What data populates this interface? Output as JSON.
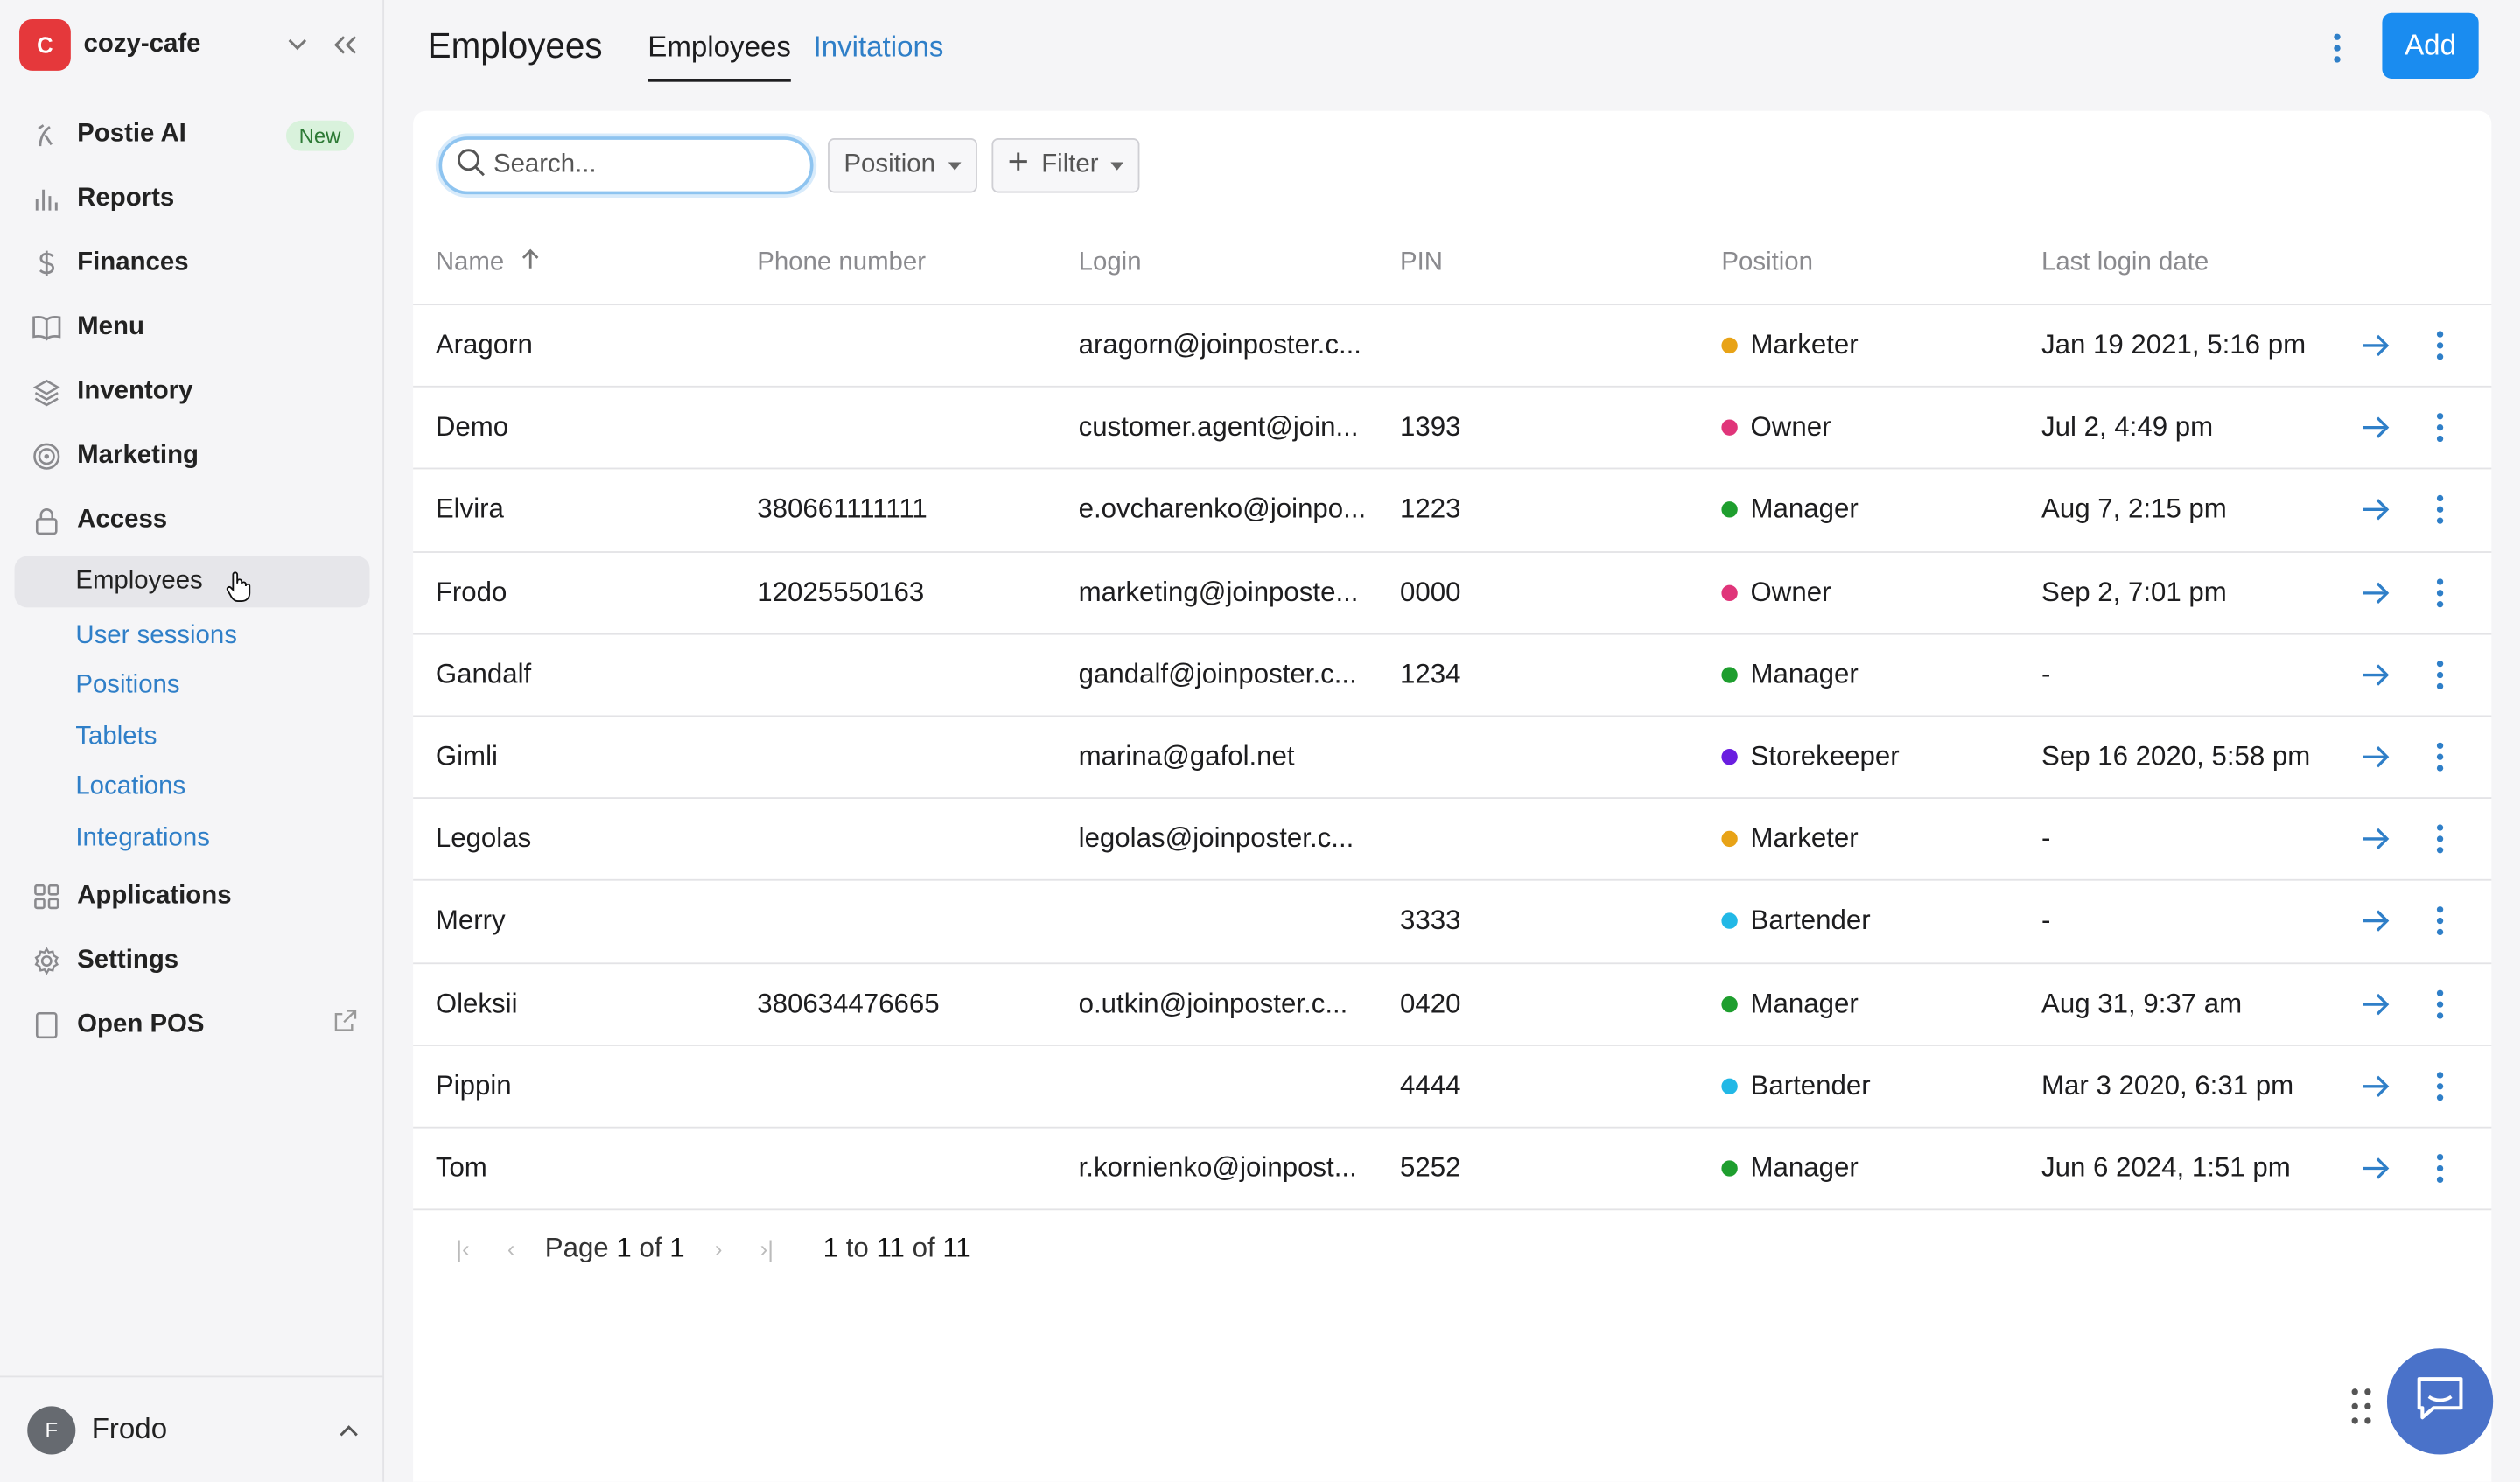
{
  "brand": {
    "initial": "C",
    "name": "cozy-cafe",
    "color": "#e5383b"
  },
  "sidebar": {
    "items": [
      {
        "label": "Postie AI",
        "icon": "postie-icon",
        "badge": "New"
      },
      {
        "label": "Reports",
        "icon": "bar-chart-icon"
      },
      {
        "label": "Finances",
        "icon": "dollar-icon"
      },
      {
        "label": "Menu",
        "icon": "book-icon"
      },
      {
        "label": "Inventory",
        "icon": "layers-icon"
      },
      {
        "label": "Marketing",
        "icon": "target-icon"
      },
      {
        "label": "Access",
        "icon": "lock-icon"
      }
    ],
    "access_sub": [
      "Employees",
      "User sessions",
      "Positions",
      "Tablets",
      "Locations",
      "Integrations"
    ],
    "active_sub": "Employees",
    "bottom_items": [
      {
        "label": "Applications",
        "icon": "grid-icon"
      },
      {
        "label": "Settings",
        "icon": "gear-icon"
      },
      {
        "label": "Open POS",
        "icon": "tablet-icon"
      }
    ]
  },
  "user": {
    "initial": "F",
    "name": "Frodo"
  },
  "header": {
    "title": "Employees",
    "tabs": [
      "Employees",
      "Invitations"
    ],
    "add_label": "Add"
  },
  "toolbar": {
    "search_placeholder": "Search...",
    "position_label": "Position",
    "filter_label": "Filter"
  },
  "table": {
    "columns": [
      "Name",
      "Phone number",
      "Login",
      "PIN",
      "Position",
      "Last login date"
    ],
    "rows": [
      {
        "name": "Aragorn",
        "phone": "",
        "login": "aragorn@joinposter.c...",
        "pin": "",
        "position": "Marketer",
        "color": "#e8a317",
        "date": "Jan 19 2021, 5:16 pm"
      },
      {
        "name": "Demo",
        "phone": "",
        "login": "customer.agent@join...",
        "pin": "1393",
        "position": "Owner",
        "color": "#e0357a",
        "date": "Jul 2, 4:49 pm"
      },
      {
        "name": "Elvira",
        "phone": "380661111111",
        "login": "e.ovcharenko@joinpo...",
        "pin": "1223",
        "position": "Manager",
        "color": "#1e9e2e",
        "date": "Aug 7, 2:15 pm"
      },
      {
        "name": "Frodo",
        "phone": "12025550163",
        "login": "marketing@joinposte...",
        "pin": "0000",
        "position": "Owner",
        "color": "#e0357a",
        "date": "Sep 2, 7:01 pm"
      },
      {
        "name": "Gandalf",
        "phone": "",
        "login": "gandalf@joinposter.c...",
        "pin": "1234",
        "position": "Manager",
        "color": "#1e9e2e",
        "date": "-"
      },
      {
        "name": "Gimli",
        "phone": "",
        "login": "marina@gafol.net",
        "pin": "",
        "position": "Storekeeper",
        "color": "#6a1ee0",
        "date": "Sep 16 2020, 5:58 pm"
      },
      {
        "name": "Legolas",
        "phone": "",
        "login": "legolas@joinposter.c...",
        "pin": "",
        "position": "Marketer",
        "color": "#e8a317",
        "date": "-"
      },
      {
        "name": "Merry",
        "phone": "",
        "login": "",
        "pin": "3333",
        "position": "Bartender",
        "color": "#22b8e6",
        "date": "-"
      },
      {
        "name": "Oleksii",
        "phone": "380634476665",
        "login": "o.utkin@joinposter.c...",
        "pin": "0420",
        "position": "Manager",
        "color": "#1e9e2e",
        "date": "Aug 31, 9:37 am"
      },
      {
        "name": "Pippin",
        "phone": "",
        "login": "",
        "pin": "4444",
        "position": "Bartender",
        "color": "#22b8e6",
        "date": "Mar 3 2020, 6:31 pm"
      },
      {
        "name": "Tom",
        "phone": "",
        "login": "r.kornienko@joinpost...",
        "pin": "5252",
        "position": "Manager",
        "color": "#1e9e2e",
        "date": "Jun 6 2024, 1:51 pm"
      }
    ]
  },
  "pager": {
    "page_word": "Page",
    "page": "1",
    "of_word": "of",
    "total_pages": "1",
    "range_from": "1",
    "to_word": "to",
    "range_to": "11",
    "range_total": "11"
  }
}
